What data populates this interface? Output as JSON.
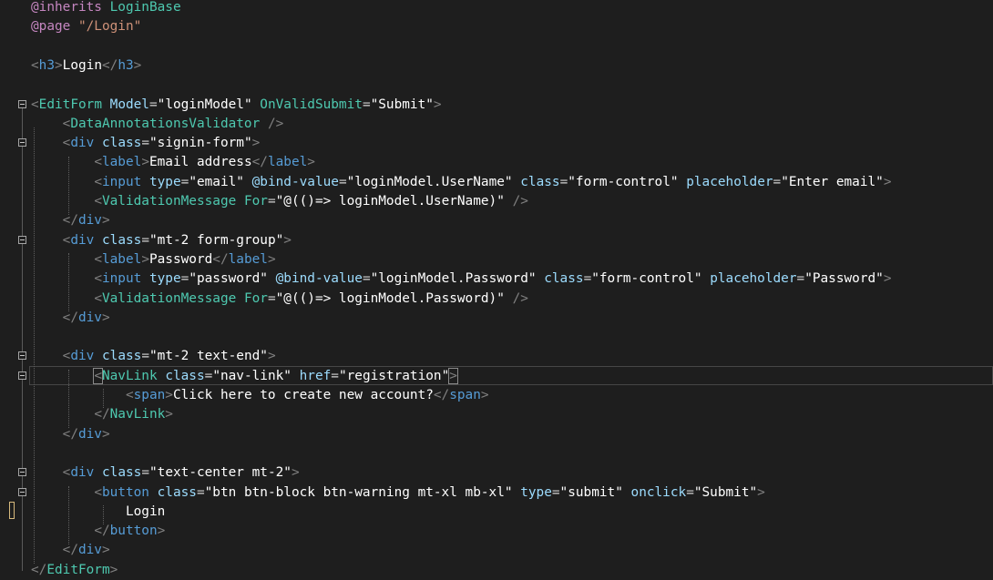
{
  "editor": {
    "lines": [
      [
        {
          "t": "kw",
          "s": "@inherits "
        },
        {
          "t": "comp",
          "s": "LoginBase"
        }
      ],
      [
        {
          "t": "kw",
          "s": "@page "
        },
        {
          "t": "str",
          "s": "\"/Login\""
        }
      ],
      [],
      [
        {
          "t": "br",
          "s": "<"
        },
        {
          "t": "tag",
          "s": "h3"
        },
        {
          "t": "br",
          "s": ">"
        },
        {
          "t": "txt",
          "s": "Login"
        },
        {
          "t": "br",
          "s": "</"
        },
        {
          "t": "tag",
          "s": "h3"
        },
        {
          "t": "br",
          "s": ">"
        }
      ],
      [],
      [
        {
          "t": "br",
          "s": "<"
        },
        {
          "t": "comp",
          "s": "EditForm"
        },
        {
          "t": "eq",
          "s": " "
        },
        {
          "t": "attr",
          "s": "Model"
        },
        {
          "t": "eq",
          "s": "="
        },
        {
          "t": "val",
          "s": "\"loginModel\""
        },
        {
          "t": "eq",
          "s": " "
        },
        {
          "t": "comp",
          "s": "OnValidSubmit"
        },
        {
          "t": "eq",
          "s": "="
        },
        {
          "t": "val",
          "s": "\"Submit\""
        },
        {
          "t": "br",
          "s": ">"
        }
      ],
      [
        {
          "t": "eq",
          "s": "    "
        },
        {
          "t": "br",
          "s": "<"
        },
        {
          "t": "comp",
          "s": "DataAnnotationsValidator"
        },
        {
          "t": "eq",
          "s": " "
        },
        {
          "t": "br",
          "s": "/>"
        }
      ],
      [
        {
          "t": "eq",
          "s": "    "
        },
        {
          "t": "br",
          "s": "<"
        },
        {
          "t": "tag",
          "s": "div"
        },
        {
          "t": "eq",
          "s": " "
        },
        {
          "t": "attr",
          "s": "class"
        },
        {
          "t": "eq",
          "s": "="
        },
        {
          "t": "val",
          "s": "\"signin-form\""
        },
        {
          "t": "br",
          "s": ">"
        }
      ],
      [
        {
          "t": "eq",
          "s": "        "
        },
        {
          "t": "br",
          "s": "<"
        },
        {
          "t": "tag",
          "s": "label"
        },
        {
          "t": "br",
          "s": ">"
        },
        {
          "t": "txt",
          "s": "Email address"
        },
        {
          "t": "br",
          "s": "</"
        },
        {
          "t": "tag",
          "s": "label"
        },
        {
          "t": "br",
          "s": ">"
        }
      ],
      [
        {
          "t": "eq",
          "s": "        "
        },
        {
          "t": "br",
          "s": "<"
        },
        {
          "t": "tag",
          "s": "input"
        },
        {
          "t": "eq",
          "s": " "
        },
        {
          "t": "attr",
          "s": "type"
        },
        {
          "t": "eq",
          "s": "="
        },
        {
          "t": "val",
          "s": "\"email\""
        },
        {
          "t": "eq",
          "s": " "
        },
        {
          "t": "attr",
          "s": "@bind-value"
        },
        {
          "t": "eq",
          "s": "="
        },
        {
          "t": "val",
          "s": "\"loginModel.UserName\""
        },
        {
          "t": "eq",
          "s": " "
        },
        {
          "t": "attr",
          "s": "class"
        },
        {
          "t": "eq",
          "s": "="
        },
        {
          "t": "val",
          "s": "\"form-control\""
        },
        {
          "t": "eq",
          "s": " "
        },
        {
          "t": "attr",
          "s": "placeholder"
        },
        {
          "t": "eq",
          "s": "="
        },
        {
          "t": "val",
          "s": "\"Enter email\""
        },
        {
          "t": "br",
          "s": ">"
        }
      ],
      [
        {
          "t": "eq",
          "s": "        "
        },
        {
          "t": "br",
          "s": "<"
        },
        {
          "t": "comp",
          "s": "ValidationMessage"
        },
        {
          "t": "eq",
          "s": " "
        },
        {
          "t": "comp",
          "s": "For"
        },
        {
          "t": "eq",
          "s": "="
        },
        {
          "t": "val",
          "s": "\"@(()=> loginModel.UserName)\""
        },
        {
          "t": "eq",
          "s": " "
        },
        {
          "t": "br",
          "s": "/>"
        }
      ],
      [
        {
          "t": "eq",
          "s": "    "
        },
        {
          "t": "br",
          "s": "</"
        },
        {
          "t": "tag",
          "s": "div"
        },
        {
          "t": "br",
          "s": ">"
        }
      ],
      [
        {
          "t": "eq",
          "s": "    "
        },
        {
          "t": "br",
          "s": "<"
        },
        {
          "t": "tag",
          "s": "div"
        },
        {
          "t": "eq",
          "s": " "
        },
        {
          "t": "attr",
          "s": "class"
        },
        {
          "t": "eq",
          "s": "="
        },
        {
          "t": "val",
          "s": "\"mt-2 form-group\""
        },
        {
          "t": "br",
          "s": ">"
        }
      ],
      [
        {
          "t": "eq",
          "s": "        "
        },
        {
          "t": "br",
          "s": "<"
        },
        {
          "t": "tag",
          "s": "label"
        },
        {
          "t": "br",
          "s": ">"
        },
        {
          "t": "txt",
          "s": "Password"
        },
        {
          "t": "br",
          "s": "</"
        },
        {
          "t": "tag",
          "s": "label"
        },
        {
          "t": "br",
          "s": ">"
        }
      ],
      [
        {
          "t": "eq",
          "s": "        "
        },
        {
          "t": "br",
          "s": "<"
        },
        {
          "t": "tag",
          "s": "input"
        },
        {
          "t": "eq",
          "s": " "
        },
        {
          "t": "attr",
          "s": "type"
        },
        {
          "t": "eq",
          "s": "="
        },
        {
          "t": "val",
          "s": "\"password\""
        },
        {
          "t": "eq",
          "s": " "
        },
        {
          "t": "attr",
          "s": "@bind-value"
        },
        {
          "t": "eq",
          "s": "="
        },
        {
          "t": "val",
          "s": "\"loginModel.Password\""
        },
        {
          "t": "eq",
          "s": " "
        },
        {
          "t": "attr",
          "s": "class"
        },
        {
          "t": "eq",
          "s": "="
        },
        {
          "t": "val",
          "s": "\"form-control\""
        },
        {
          "t": "eq",
          "s": " "
        },
        {
          "t": "attr",
          "s": "placeholder"
        },
        {
          "t": "eq",
          "s": "="
        },
        {
          "t": "val",
          "s": "\"Password\""
        },
        {
          "t": "br",
          "s": ">"
        }
      ],
      [
        {
          "t": "eq",
          "s": "        "
        },
        {
          "t": "br",
          "s": "<"
        },
        {
          "t": "comp",
          "s": "ValidationMessage"
        },
        {
          "t": "eq",
          "s": " "
        },
        {
          "t": "comp",
          "s": "For"
        },
        {
          "t": "eq",
          "s": "="
        },
        {
          "t": "val",
          "s": "\"@(()=> loginModel.Password)\""
        },
        {
          "t": "eq",
          "s": " "
        },
        {
          "t": "br",
          "s": "/>"
        }
      ],
      [
        {
          "t": "eq",
          "s": "    "
        },
        {
          "t": "br",
          "s": "</"
        },
        {
          "t": "tag",
          "s": "div"
        },
        {
          "t": "br",
          "s": ">"
        }
      ],
      [],
      [
        {
          "t": "eq",
          "s": "    "
        },
        {
          "t": "br",
          "s": "<"
        },
        {
          "t": "tag",
          "s": "div"
        },
        {
          "t": "eq",
          "s": " "
        },
        {
          "t": "attr",
          "s": "class"
        },
        {
          "t": "eq",
          "s": "="
        },
        {
          "t": "val",
          "s": "\"mt-2 text-end\""
        },
        {
          "t": "br",
          "s": ">"
        }
      ],
      [
        {
          "t": "eq",
          "s": "        "
        },
        {
          "t": "br",
          "s": "<",
          "m": 1
        },
        {
          "t": "comp",
          "s": "NavLink"
        },
        {
          "t": "eq",
          "s": " "
        },
        {
          "t": "attr",
          "s": "class"
        },
        {
          "t": "eq",
          "s": "="
        },
        {
          "t": "val",
          "s": "\"nav-link\""
        },
        {
          "t": "eq",
          "s": " "
        },
        {
          "t": "attr",
          "s": "href"
        },
        {
          "t": "eq",
          "s": "="
        },
        {
          "t": "val",
          "s": "\"registration\""
        },
        {
          "t": "br",
          "s": ">",
          "m": 1
        }
      ],
      [
        {
          "t": "eq",
          "s": "            "
        },
        {
          "t": "br",
          "s": "<"
        },
        {
          "t": "tag",
          "s": "span"
        },
        {
          "t": "br",
          "s": ">"
        },
        {
          "t": "txt",
          "s": "Click here to create new account?"
        },
        {
          "t": "br",
          "s": "</"
        },
        {
          "t": "tag",
          "s": "span"
        },
        {
          "t": "br",
          "s": ">"
        }
      ],
      [
        {
          "t": "eq",
          "s": "        "
        },
        {
          "t": "br",
          "s": "</"
        },
        {
          "t": "comp",
          "s": "NavLink"
        },
        {
          "t": "br",
          "s": ">"
        }
      ],
      [
        {
          "t": "eq",
          "s": "    "
        },
        {
          "t": "br",
          "s": "</"
        },
        {
          "t": "tag",
          "s": "div"
        },
        {
          "t": "br",
          "s": ">"
        }
      ],
      [],
      [
        {
          "t": "eq",
          "s": "    "
        },
        {
          "t": "br",
          "s": "<"
        },
        {
          "t": "tag",
          "s": "div"
        },
        {
          "t": "eq",
          "s": " "
        },
        {
          "t": "attr",
          "s": "class"
        },
        {
          "t": "eq",
          "s": "="
        },
        {
          "t": "val",
          "s": "\"text-center mt-2\""
        },
        {
          "t": "br",
          "s": ">"
        }
      ],
      [
        {
          "t": "eq",
          "s": "        "
        },
        {
          "t": "br",
          "s": "<"
        },
        {
          "t": "tag",
          "s": "button"
        },
        {
          "t": "eq",
          "s": " "
        },
        {
          "t": "attr",
          "s": "class"
        },
        {
          "t": "eq",
          "s": "="
        },
        {
          "t": "val",
          "s": "\"btn btn-block btn-warning mt-xl mb-xl\""
        },
        {
          "t": "eq",
          "s": " "
        },
        {
          "t": "attr",
          "s": "type"
        },
        {
          "t": "eq",
          "s": "="
        },
        {
          "t": "val",
          "s": "\"submit\""
        },
        {
          "t": "eq",
          "s": " "
        },
        {
          "t": "attr",
          "s": "onclick"
        },
        {
          "t": "eq",
          "s": "="
        },
        {
          "t": "val",
          "s": "\"Submit\""
        },
        {
          "t": "br",
          "s": ">"
        }
      ],
      [
        {
          "t": "eq",
          "s": "            "
        },
        {
          "t": "txt",
          "s": "Login"
        }
      ],
      [
        {
          "t": "eq",
          "s": "        "
        },
        {
          "t": "br",
          "s": "</"
        },
        {
          "t": "tag",
          "s": "button"
        },
        {
          "t": "br",
          "s": ">"
        }
      ],
      [
        {
          "t": "eq",
          "s": "    "
        },
        {
          "t": "br",
          "s": "</"
        },
        {
          "t": "tag",
          "s": "div"
        },
        {
          "t": "br",
          "s": ">"
        }
      ],
      [
        {
          "t": "br",
          "s": "</"
        },
        {
          "t": "comp",
          "s": "EditForm"
        },
        {
          "t": "br",
          "s": ">"
        }
      ]
    ],
    "fold_lines": [
      5,
      7,
      12,
      18,
      19,
      24,
      25
    ],
    "colors": {
      "background": "#1e1e1e",
      "directive": "#c586c0",
      "string": "#ce9178",
      "tag": "#569cd6",
      "component": "#4ec9b0",
      "attribute": "#9cdcfe"
    }
  }
}
